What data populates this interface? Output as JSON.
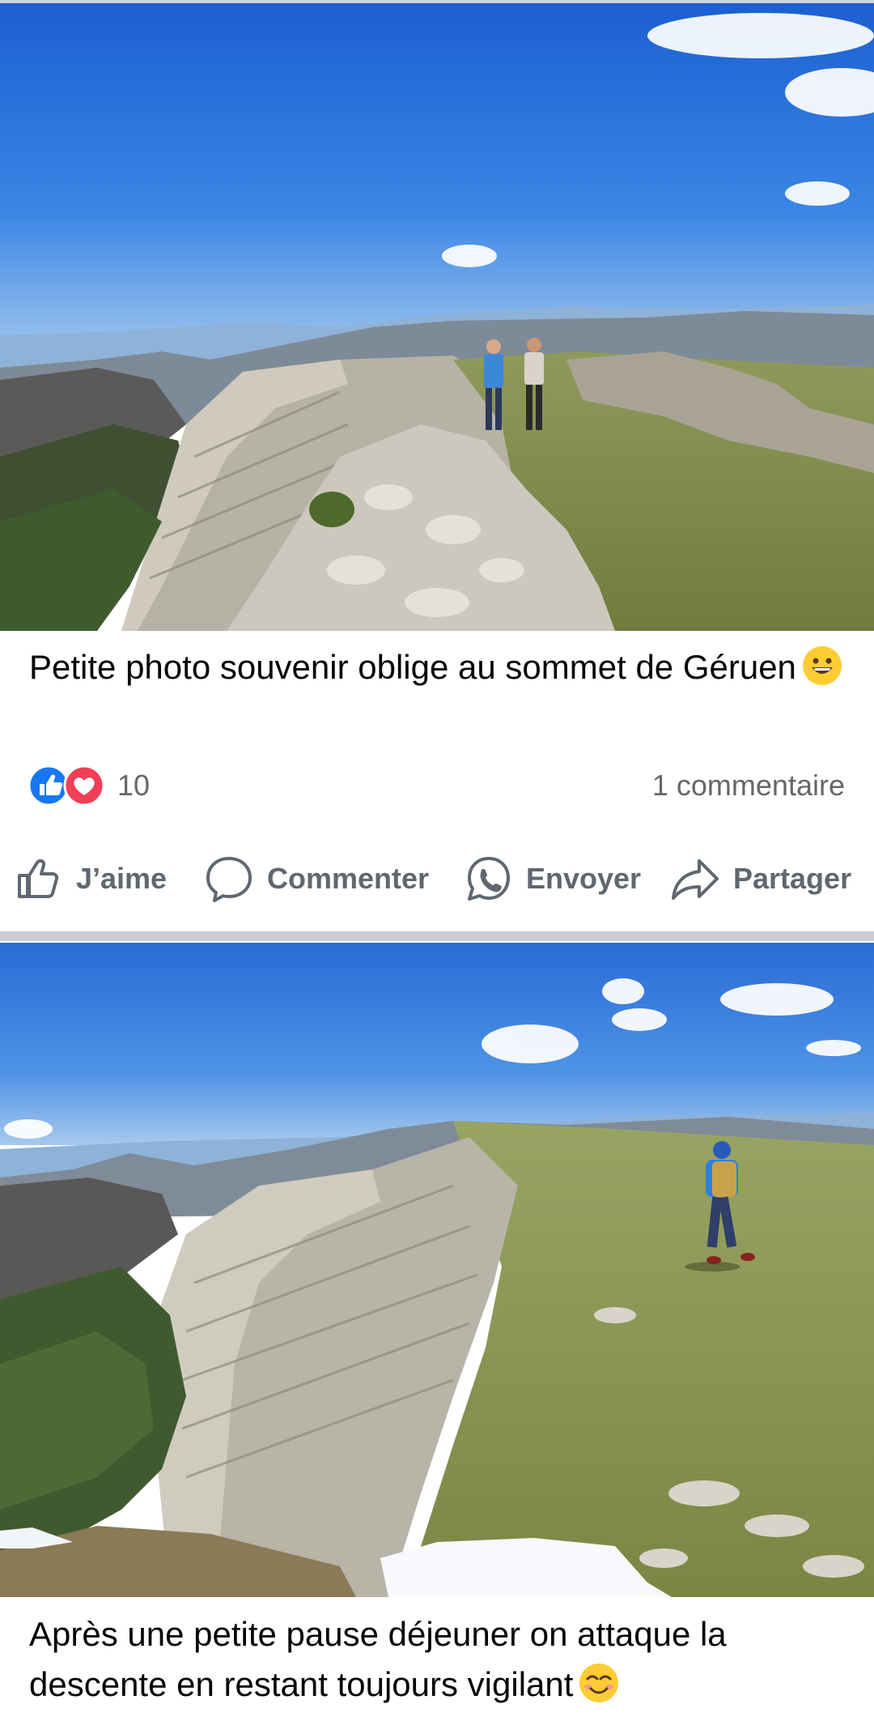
{
  "posts": [
    {
      "caption": "Petite photo souvenir oblige au sommet de Géruen",
      "caption_emoji": "grinning-face-emoji",
      "photo": "photo-ridge-summit-two-hikers",
      "reactions": {
        "icons": [
          "like-reaction-icon",
          "love-reaction-icon"
        ],
        "count": "10"
      },
      "comments_label": "1 commentaire",
      "actions": {
        "like": "J’aime",
        "comment": "Commenter",
        "send": "Envoyer",
        "share": "Partager"
      }
    },
    {
      "caption": "Après une petite pause déjeuner on attaque la descente en restant toujours vigilant",
      "caption_emoji": "smiling-face-with-smiling-eyes-emoji",
      "photo": "photo-ridge-descent-hiker-backpack"
    }
  ],
  "colors": {
    "like_blue": "#1877f2",
    "love_red": "#f33e58",
    "action_grey": "#606770",
    "meta_grey": "#65676b",
    "separator": "#c9ccd1"
  }
}
